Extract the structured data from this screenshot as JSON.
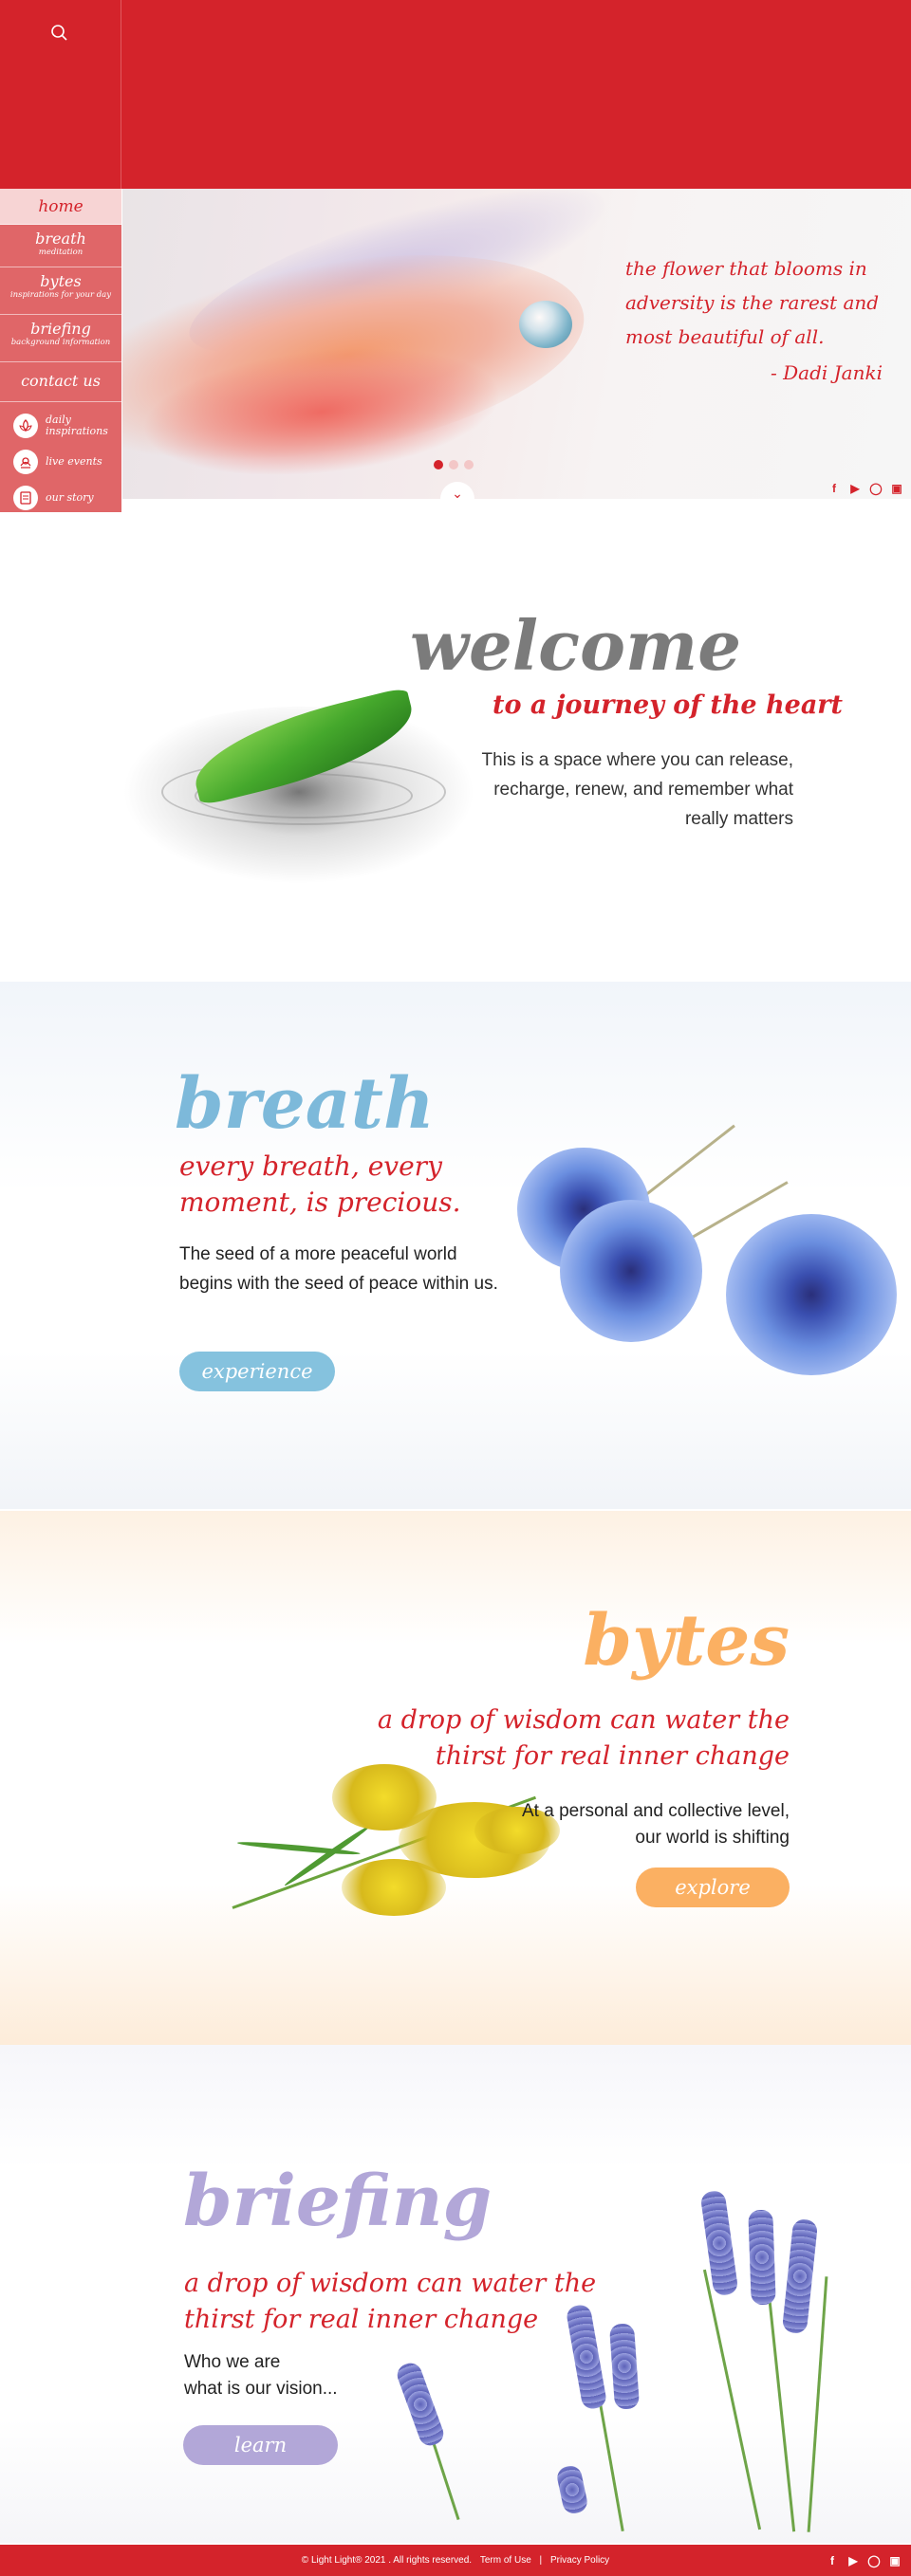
{
  "header": {
    "search_icon": "search-icon"
  },
  "sidebar": {
    "home": "home",
    "breath": {
      "label": "breath",
      "sub": "meditation"
    },
    "bytes": {
      "label": "bytes",
      "sub": "inspirations for your day"
    },
    "briefing": {
      "label": "briefing",
      "sub": "background information"
    },
    "contact": "contact us",
    "extras": [
      {
        "icon": "lotus-icon",
        "label_1": "daily",
        "label_2": "inspirations"
      },
      {
        "icon": "live-events-icon",
        "label_1": "live events",
        "label_2": ""
      },
      {
        "icon": "story-icon",
        "label_1": "our story",
        "label_2": ""
      }
    ]
  },
  "hero": {
    "quote": "the flower that blooms in adversity is the rarest and most beautiful of all.",
    "author": "- Dadi Janki",
    "slides_total": 3,
    "active_slide": 1
  },
  "welcome": {
    "title": "welcome",
    "subtitle": "to a journey of the heart",
    "text": "This is a space where you can release, recharge, renew, and remember what really matters"
  },
  "breath": {
    "title": "breath",
    "subtitle": "every breath, every moment, is precious.",
    "text": "The seed of a more peaceful world begins with the seed of peace within us.",
    "button": "experience"
  },
  "bytes": {
    "title": "bytes",
    "subtitle": "a drop of wisdom can water the thirst for real inner change",
    "text": "At a personal and collective level, our world is shifting",
    "button": "explore"
  },
  "briefing": {
    "title": "briefing",
    "subtitle": "a drop of wisdom can water the thirst for real inner change",
    "text_1": "Who we are",
    "text_2": "what is our vision...",
    "button": "learn"
  },
  "footer": {
    "copyright": "© Light Light® 2021 . All rights reserved.",
    "terms": "Term of Use",
    "separator": "|",
    "privacy": "Privacy Policy"
  },
  "social": [
    "facebook-icon",
    "youtube-icon",
    "instagram-icon",
    "app-icon"
  ],
  "colors": {
    "brand_red": "#d4232b",
    "breath_blue": "#85c2de",
    "bytes_orange": "#fbb062",
    "briefing_purple": "#b2a7d8"
  }
}
